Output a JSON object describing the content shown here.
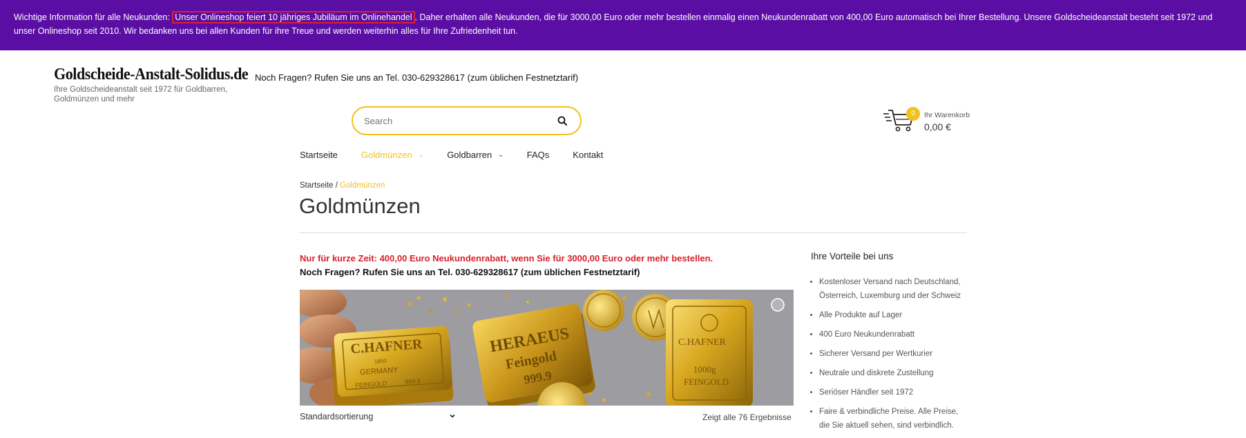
{
  "notice": {
    "prefix": "Wichtige Information für alle Neukunden: ",
    "highlight": "Unser Onlineshop feiert 10 jähriges Jubiläum im Onlinehandel",
    "rest": ". Daher erhalten alle Neukunden, die für 3000,00 Euro oder mehr bestellen einmalig einen Neukundenrabatt von 400,00 Euro automatisch bei Ihrer Bestellung. Unsere Goldscheideanstalt besteht seit 1972 und unser Onlineshop seit 2010. Wir bedanken uns bei allen Kunden für ihre Treue und werden weiterhin alles für Ihre Zufriedenheit tun.",
    "highlight_color": "#e0202a",
    "background": "#5b0ea3"
  },
  "header": {
    "logo_name": "Goldscheide-Anstalt-Solidus.de",
    "logo_tagline": "Ihre Goldscheideanstalt seit 1972 für Goldbarren, Goldmünzen und mehr",
    "hotline": "Noch Fragen? Rufen Sie uns an Tel. 030-629328617 (zum üblichen Festnetztarif)"
  },
  "search": {
    "placeholder": "Search",
    "icon": "search-icon"
  },
  "cart": {
    "count": "0",
    "label": "Ihr Warenkorb",
    "amount": "0,00 €",
    "icon": "cart-icon"
  },
  "nav": {
    "items": [
      {
        "label": "Startseite"
      },
      {
        "label": "Goldmünzen",
        "active": true,
        "has_dropdown": true
      },
      {
        "label": "Goldbarren",
        "has_dropdown": true
      },
      {
        "label": "FAQs"
      },
      {
        "label": "Kontakt"
      }
    ]
  },
  "breadcrumb": {
    "home": "Startseite",
    "separator": " / ",
    "current": "Goldmünzen"
  },
  "page_title": "Goldmünzen",
  "promo": {
    "line1": "Nur für kurze Zeit: 400,00 Euro Neukundenrabatt, wenn Sie für 3000,00 Euro oder mehr bestellen.",
    "line2": "Noch Fragen? Rufen Sie uns an Tel. 030-629328617 (zum üblichen Festnetztarif)"
  },
  "banner": {
    "bar1": {
      "brand": "C.HAFNER",
      "sub": "GERMANY",
      "purity": "999.9",
      "weight": "FEINGOLD",
      "year": "1850"
    },
    "bar2": {
      "brand": "HERAEUS",
      "sub": "Feingold",
      "purity": "999.9"
    },
    "bar3": {
      "brand": "C.HAFNER",
      "weight": "1000g",
      "purity": "FEINGOLD"
    }
  },
  "listing": {
    "sort_label": "Standardsortierung",
    "results": "Zeigt alle 76 Ergebnisse"
  },
  "sidebar": {
    "title": "Ihre Vorteile bei uns",
    "items": [
      "Kostenloser Versand nach Deutschland, Österreich, Luxemburg und der Schweiz",
      "Alle Produkte auf Lager",
      "400 Euro Neukundenrabatt",
      "Sicherer Versand per Wertkurier",
      "Neutrale und diskrete Zustellung",
      "Seriöser Händler seit 1972",
      "Faire & verbindliche Preise. Alle Preise, die Sie aktuell sehen, sind verbindlich."
    ]
  },
  "colors": {
    "accent": "#f2c11b",
    "promo_red": "#d8202a"
  }
}
